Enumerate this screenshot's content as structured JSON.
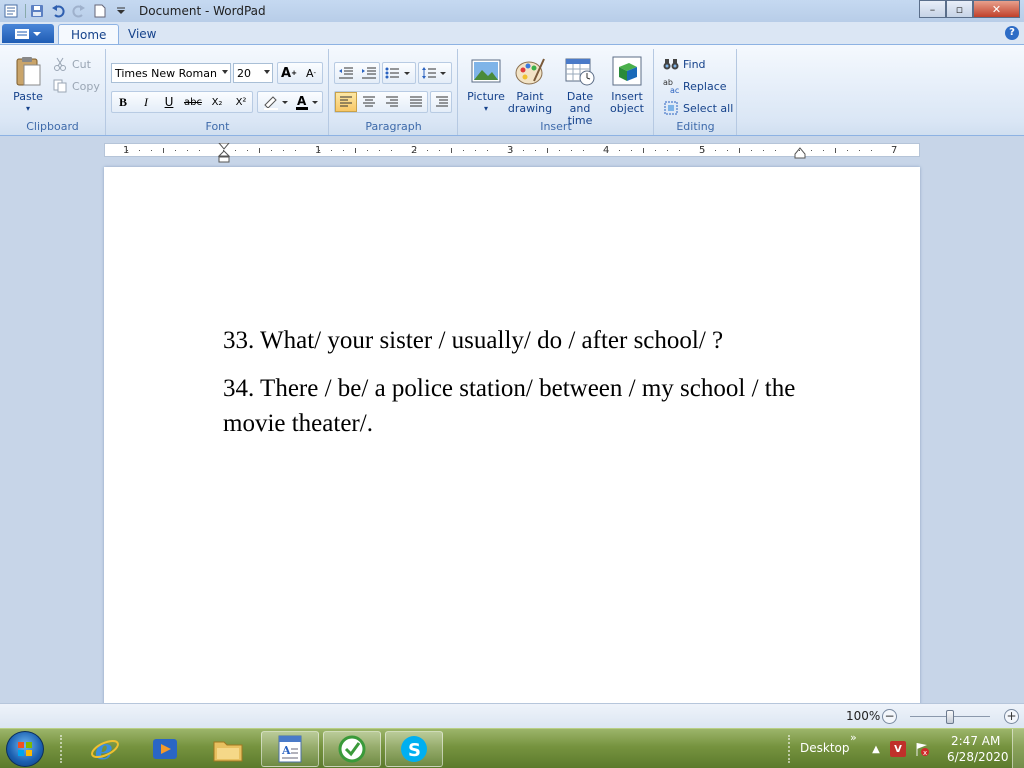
{
  "window": {
    "title": "Document - WordPad",
    "controls": {
      "minimize": "–",
      "maximize": "▫",
      "close": "✕"
    }
  },
  "tabs": [
    {
      "label": "Home",
      "active": true
    },
    {
      "label": "View",
      "active": false
    }
  ],
  "ribbon": {
    "clipboard": {
      "label": "Clipboard",
      "paste": "Paste",
      "cut": "Cut",
      "copy": "Copy"
    },
    "font": {
      "label": "Font",
      "family": "Times New Roman",
      "size": "20",
      "bold": "B",
      "italic": "I",
      "underline": "U",
      "strike": "abc",
      "subscript": "X₂",
      "superscript": "X²"
    },
    "paragraph": {
      "label": "Paragraph"
    },
    "insert": {
      "label": "Insert",
      "picture": [
        "Picture",
        ""
      ],
      "paint": [
        "Paint",
        "drawing"
      ],
      "datetime": [
        "Date and",
        "time"
      ],
      "object": [
        "Insert",
        "object"
      ]
    },
    "editing": {
      "label": "Editing",
      "find": "Find",
      "replace": "Replace",
      "select_all": "Select all"
    }
  },
  "ruler": {
    "numbers": [
      "1",
      "1",
      "2",
      "3",
      "4",
      "5",
      "7"
    ]
  },
  "document": {
    "paragraphs": [
      "33. What/ your sister / usually/ do / after school/ ?",
      "34. There / be/ a police station/ between / my school / the movie theater/."
    ]
  },
  "status": {
    "zoom": "100%",
    "zoom_level": 1.0
  },
  "taskbar": {
    "desktop_label": "Desktop",
    "time": "2:47 AM",
    "date": "6/28/2020"
  }
}
